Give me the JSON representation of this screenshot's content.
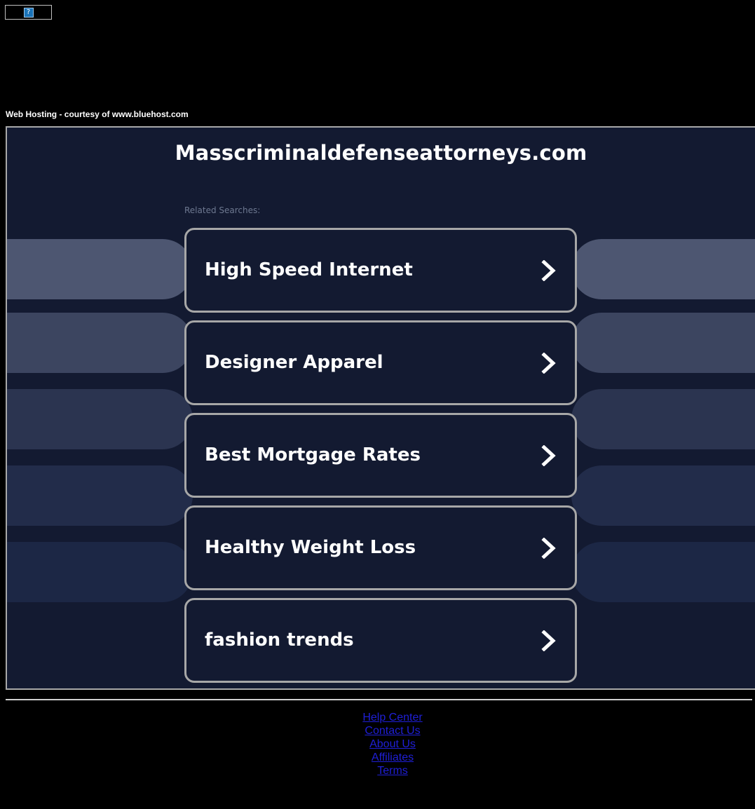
{
  "banner": {
    "broken_image_glyph": "?"
  },
  "hosting_credit": "Web Hosting - courtesy of www.bluehost.com",
  "domain_title": "Masscriminaldefenseattorneys.com",
  "related_label": "Related Searches:",
  "related_searches": [
    {
      "label": "High Speed Internet"
    },
    {
      "label": "Designer Apparel"
    },
    {
      "label": "Best Mortgage Rates"
    },
    {
      "label": "Healthy Weight Loss"
    },
    {
      "label": "fashion trends"
    }
  ],
  "chevron_icon": "chevron-right-icon",
  "colors": {
    "page_background": "#000000",
    "frame_background": "#131a31",
    "card_border": "#a7a7a7",
    "side_pill_shades": [
      "#4d5671",
      "#3c4560",
      "#2b3450",
      "#222c4a",
      "#1c2745"
    ],
    "footer_link": "#1f1fd6"
  },
  "footer": {
    "links": [
      "Help Center",
      "Contact Us",
      "About Us",
      "Affiliates",
      "Terms"
    ]
  }
}
